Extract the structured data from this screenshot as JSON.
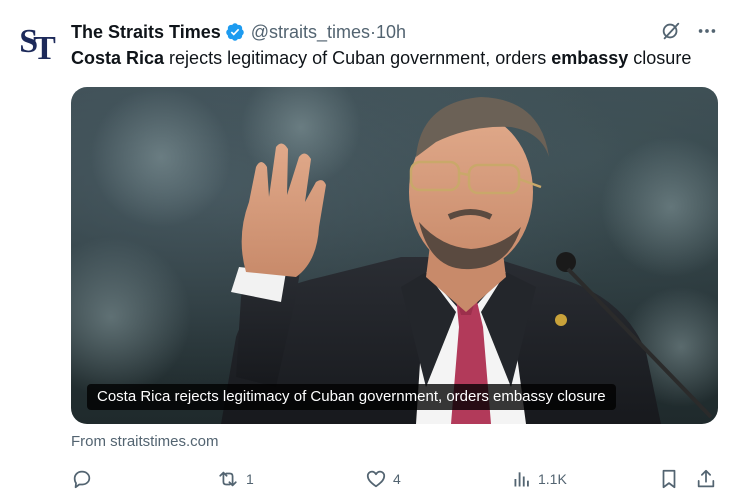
{
  "account": {
    "avatar_text_s": "S",
    "avatar_text_t": "T",
    "name": "The Straits Times",
    "handle": "@straits_times",
    "separator": " · ",
    "time": "10h"
  },
  "tweet": {
    "text_parts": [
      {
        "text": "Costa Rica",
        "bold": true
      },
      {
        "text": " rejects legitimacy of Cuban government, orders ",
        "bold": false
      },
      {
        "text": "embassy",
        "bold": true
      },
      {
        "text": " closure",
        "bold": false
      }
    ]
  },
  "card": {
    "caption": "Costa Rica rejects legitimacy of Cuban government, orders embassy closure",
    "source": "From straitstimes.com"
  },
  "actions": {
    "reply_count": "",
    "retweet_count": "1",
    "like_count": "4",
    "views_count": "1.1K"
  },
  "icons": {
    "verified": "verified-badge-icon",
    "grok": "grok-icon",
    "more": "more-icon",
    "reply": "reply-icon",
    "retweet": "retweet-icon",
    "like": "like-icon",
    "views": "views-icon",
    "bookmark": "bookmark-icon",
    "share": "share-icon"
  },
  "colors": {
    "verified": "#1d9bf0",
    "muted": "#536471",
    "text": "#0f1419"
  }
}
